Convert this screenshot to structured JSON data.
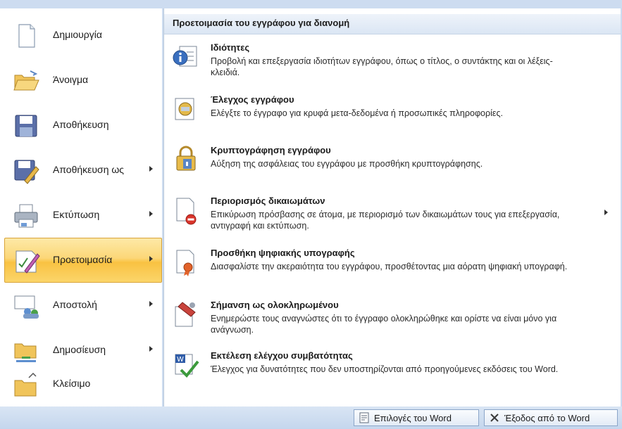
{
  "left_menu": {
    "items": [
      {
        "label": "Δημιουργία",
        "icon": "new-document-icon",
        "has_submenu": false
      },
      {
        "label": "Άνοιγμα",
        "icon": "open-folder-icon",
        "has_submenu": false
      },
      {
        "label": "Αποθήκευση",
        "icon": "save-disk-icon",
        "has_submenu": false
      },
      {
        "label": "Αποθήκευση ως",
        "icon": "save-as-icon",
        "has_submenu": true
      },
      {
        "label": "Εκτύπωση",
        "icon": "printer-icon",
        "has_submenu": true
      },
      {
        "label": "Προετοιμασία",
        "icon": "prepare-icon",
        "has_submenu": true,
        "active": true
      },
      {
        "label": "Αποστολή",
        "icon": "send-icon",
        "has_submenu": true
      },
      {
        "label": "Δημοσίευση",
        "icon": "publish-icon",
        "has_submenu": true
      },
      {
        "label": "Κλείσιμο",
        "icon": "close-folder-icon",
        "has_submenu": false
      }
    ]
  },
  "submenu": {
    "header": "Προετοιμασία του εγγράφου για διανομή",
    "options": [
      {
        "title": "Ιδιότητες",
        "desc": "Προβολή και επεξεργασία ιδιοτήτων εγγράφου, όπως ο τίτλος, ο συντάκτης και οι λέξεις-κλειδιά.",
        "icon": "properties-icon"
      },
      {
        "title": "Έλεγχος εγγράφου",
        "desc": "Ελέγξτε το έγγραφο για κρυφά μετα-δεδομένα ή προσωπικές πληροφορίες.",
        "icon": "inspect-document-icon"
      },
      {
        "title": "Κρυπτογράφηση εγγράφου",
        "desc": "Αύξηση της ασφάλειας του εγγράφου με προσθήκη κρυπτογράφησης.",
        "icon": "encrypt-lock-icon"
      },
      {
        "title": "Περιορισμός δικαιωμάτων",
        "desc": "Επικύρωση πρόσβασης σε άτομα, με περιορισμό των δικαιωμάτων τους για επεξεργασία, αντιγραφή και εκτύπωση.",
        "icon": "restrict-permission-icon",
        "has_submenu": true
      },
      {
        "title": "Προσθήκη ψηφιακής υπογραφής",
        "desc": "Διασφαλίστε την ακεραιότητα του εγγράφου, προσθέτοντας μια αόρατη ψηφιακή υπογραφή.",
        "icon": "digital-signature-icon"
      },
      {
        "title": "Σήμανση ως ολοκληρωμένου",
        "desc": "Ενημερώστε τους αναγνώστες ότι το έγγραφο ολοκληρώθηκε και ορίστε να είναι μόνο για ανάγνωση.",
        "icon": "mark-final-icon"
      },
      {
        "title": "Εκτέλεση ελέγχου συμβατότητας",
        "desc": "Έλεγχος για δυνατότητες που δεν υποστηρίζονται από προηγούμενες εκδόσεις του Word.",
        "icon": "compatibility-check-icon"
      }
    ]
  },
  "bottom": {
    "options_button": "Επιλογές του Word",
    "exit_button": "Έξοδος από το Word"
  }
}
